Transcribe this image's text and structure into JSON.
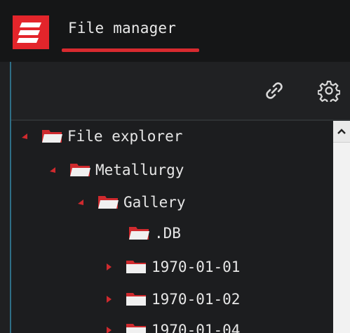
{
  "header": {
    "title": "File manager"
  },
  "toolbar": {
    "link_icon": "link-icon",
    "settings_icon": "gear-icon"
  },
  "tree": {
    "items": [
      {
        "label": "File explorer",
        "expanded": true,
        "level": 0
      },
      {
        "label": "Metallurgy",
        "expanded": true,
        "level": 1
      },
      {
        "label": "Gallery",
        "expanded": true,
        "level": 2
      },
      {
        "label": ".DB",
        "expanded": null,
        "level": 3
      },
      {
        "label": "1970-01-01",
        "expanded": false,
        "level": 3
      },
      {
        "label": "1970-01-02",
        "expanded": false,
        "level": 3
      },
      {
        "label": "1970-01-04",
        "expanded": false,
        "level": 3
      }
    ]
  },
  "colors": {
    "accent_red": "#d82a2f",
    "folder_white": "#f0f0f0",
    "folder_red": "#cf2a2e",
    "background": "#1f2022"
  }
}
